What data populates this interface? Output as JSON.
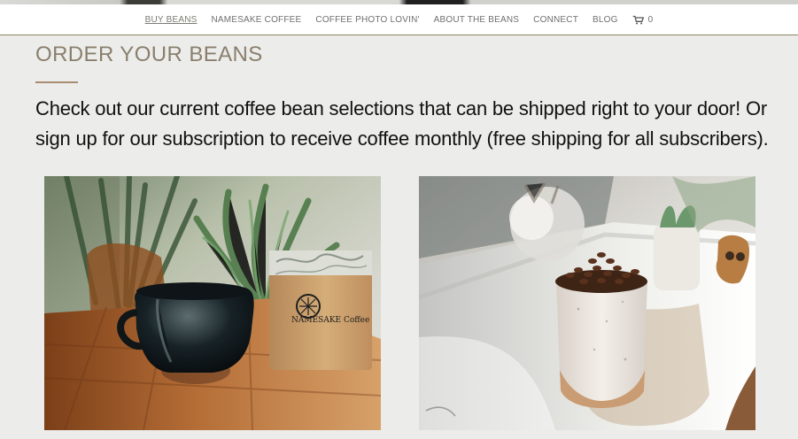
{
  "nav": {
    "items": [
      {
        "label": "BUY BEANS",
        "active": true
      },
      {
        "label": "NAMESAKE COFFEE",
        "active": false
      },
      {
        "label": "COFFEE PHOTO LOVIN'",
        "active": false
      },
      {
        "label": "ABOUT THE BEANS",
        "active": false
      },
      {
        "label": "CONNECT",
        "active": false
      },
      {
        "label": "BLOG",
        "active": false
      }
    ],
    "cart": {
      "icon": "cart-icon",
      "count": "0"
    }
  },
  "page": {
    "title": "ORDER YOUR BEANS",
    "intro": "Check out our current coffee bean selections that can be shipped right to your door! Or sign up for our subscription to receive coffee monthly (free shipping for all subscribers)."
  },
  "images": {
    "left": {
      "bag_logo": "NAMESAKE Coffee"
    },
    "right": {}
  },
  "colors": {
    "accent": "#8a7f6d",
    "rule": "#a98d73",
    "background": "#ececea"
  }
}
